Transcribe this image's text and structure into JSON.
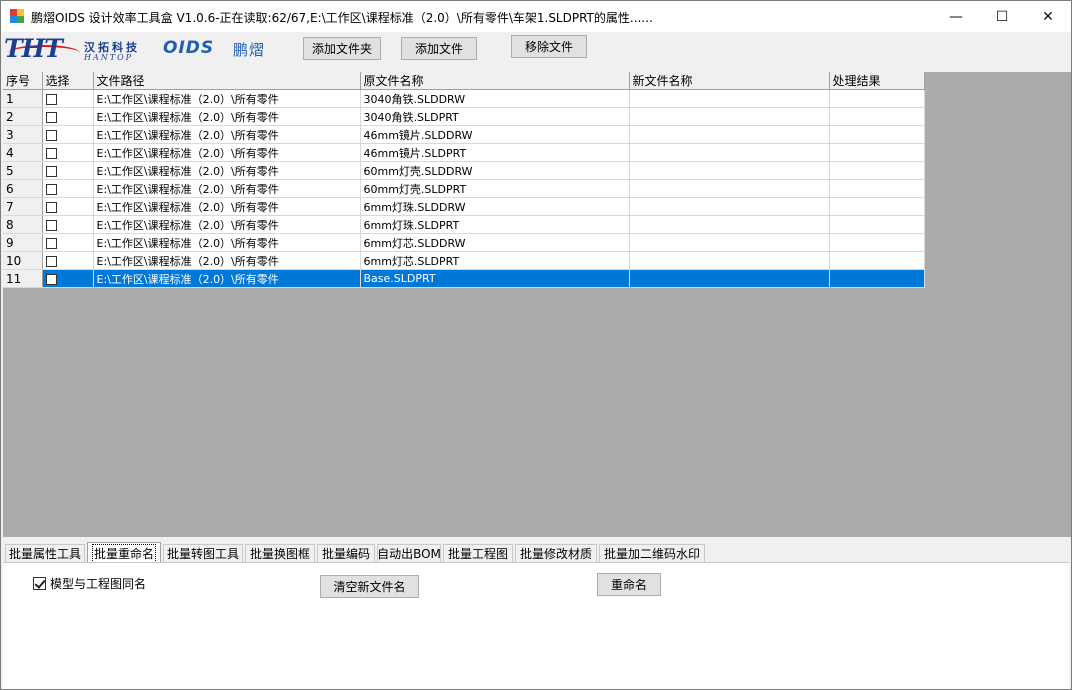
{
  "window": {
    "title": "鹏熠OIDS 设计效率工具盒 V1.0.6-正在读取:62/67,E:\\工作区\\课程标准（2.0）\\所有零件\\车架1.SLDPRT的属性......",
    "minimize": "—",
    "maximize": "☐",
    "close": "✕"
  },
  "logos": {
    "tht": "THT",
    "tht_cn": "汉拓科技",
    "tht_en": "HANTOP",
    "oids": "OIDS",
    "pengyang": "鹏熠"
  },
  "toolbar": {
    "add_folder": "添加文件夹",
    "add_file": "添加文件",
    "remove_file": "移除文件"
  },
  "grid": {
    "columns": [
      "序号",
      "选择",
      "文件路径",
      "原文件名称",
      "新文件名称",
      "处理结果"
    ],
    "rows": [
      {
        "index": "1",
        "path": "E:\\工作区\\课程标准（2.0）\\所有零件",
        "original": "3040角铁.SLDDRW",
        "new_name": "",
        "result": ""
      },
      {
        "index": "2",
        "path": "E:\\工作区\\课程标准（2.0）\\所有零件",
        "original": "3040角铁.SLDPRT",
        "new_name": "",
        "result": ""
      },
      {
        "index": "3",
        "path": "E:\\工作区\\课程标准（2.0）\\所有零件",
        "original": "46mm镜片.SLDDRW",
        "new_name": "",
        "result": ""
      },
      {
        "index": "4",
        "path": "E:\\工作区\\课程标准（2.0）\\所有零件",
        "original": "46mm镜片.SLDPRT",
        "new_name": "",
        "result": ""
      },
      {
        "index": "5",
        "path": "E:\\工作区\\课程标准（2.0）\\所有零件",
        "original": "60mm灯壳.SLDDRW",
        "new_name": "",
        "result": ""
      },
      {
        "index": "6",
        "path": "E:\\工作区\\课程标准（2.0）\\所有零件",
        "original": "60mm灯壳.SLDPRT",
        "new_name": "",
        "result": ""
      },
      {
        "index": "7",
        "path": "E:\\工作区\\课程标准（2.0）\\所有零件",
        "original": "6mm灯珠.SLDDRW",
        "new_name": "",
        "result": ""
      },
      {
        "index": "8",
        "path": "E:\\工作区\\课程标准（2.0）\\所有零件",
        "original": "6mm灯珠.SLDPRT",
        "new_name": "",
        "result": ""
      },
      {
        "index": "9",
        "path": "E:\\工作区\\课程标准（2.0）\\所有零件",
        "original": "6mm灯芯.SLDDRW",
        "new_name": "",
        "result": ""
      },
      {
        "index": "10",
        "path": "E:\\工作区\\课程标准（2.0）\\所有零件",
        "original": "6mm灯芯.SLDPRT",
        "new_name": "",
        "result": ""
      },
      {
        "index": "11",
        "path": "E:\\工作区\\课程标准（2.0）\\所有零件",
        "original": "Base.SLDPRT",
        "new_name": "",
        "result": ""
      }
    ],
    "selected_row": 11
  },
  "tabs": [
    {
      "label": "批量属性工具"
    },
    {
      "label": "批量重命名"
    },
    {
      "label": "批量转图工具"
    },
    {
      "label": "批量换图框"
    },
    {
      "label": "批量编码"
    },
    {
      "label": "自动出BOM"
    },
    {
      "label": "批量工程图"
    },
    {
      "label": "批量修改材质"
    },
    {
      "label": "批量加二维码水印"
    }
  ],
  "active_tab": 1,
  "rename_panel": {
    "same_name_label": "模型与工程图同名",
    "same_name_checked": true,
    "clear_button": "清空新文件名",
    "rename_button": "重命名"
  }
}
